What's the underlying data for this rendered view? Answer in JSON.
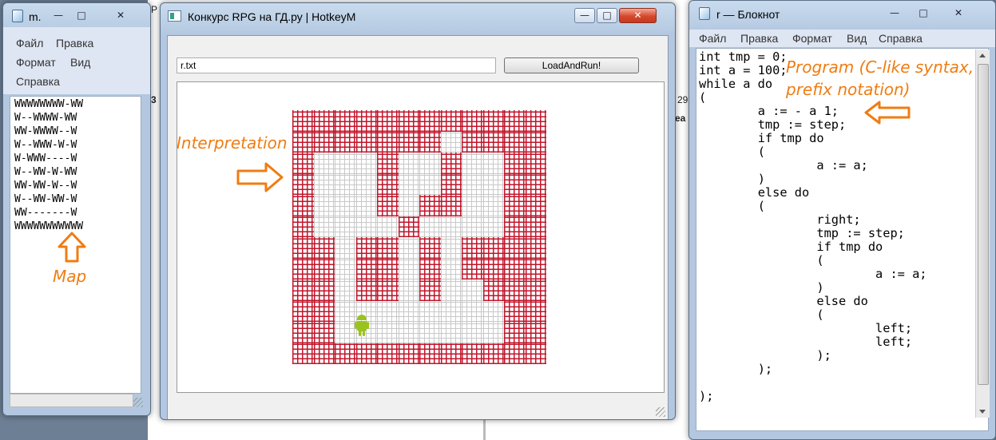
{
  "map_window": {
    "title": "m.",
    "controls": {
      "minimize": "—",
      "maximize": "□",
      "close": "✕"
    },
    "menu": [
      "Файл",
      "Правка",
      "Формат",
      "Вид",
      "Справка"
    ],
    "lines": [
      "WWWWWWWW-WW",
      "W--WWWW-WW",
      "WW-WWWW--W",
      "W--WWW-W-W",
      "W-WWW----W",
      "W--WW-W-WW",
      "WW-WW-W--W",
      "W--WW-WW-W",
      "WW-------W",
      "WWWWWWWWWWW"
    ]
  },
  "main_window": {
    "title": "Конкурс RPG на ГД.ру | HotkeyM",
    "controls": {
      "minimize": "—",
      "maximize": "□",
      "close": "✕"
    },
    "file_input_value": "r.txt",
    "run_button_label": "LoadAndRun!",
    "maze_rows": [
      "WWWWWWWWWWWW",
      "WWWWWWWFWWWW",
      "WFFFWFFWFFWW",
      "WFFFWFFWFFWW",
      "WFFFWFWWFFWW",
      "WFFFFWFFFFWW",
      "WWFWWFWFWWWW",
      "WWFWWFWFWWWW",
      "WWFWWFWFFWWW",
      "WWFFFFFFFFWW",
      "WWFFFFFFFFWW",
      "WWWWWWWWWWWW"
    ],
    "robot_icon": "android-robot-icon"
  },
  "notepad_window": {
    "title": "r — Блокнот",
    "controls": {
      "minimize": "—",
      "maximize": "□",
      "close": "✕"
    },
    "menu": [
      "Файл",
      "Правка",
      "Формат",
      "Вид",
      "Справка"
    ],
    "code": "int tmp = 0;\nint a = 100;\nwhile a do\n(\n\ta := - a 1;\n\ttmp := step;\n\tif tmp do\n\t(\n\t\ta := a;\n\t)\n\telse do\n\t(\n\t\tright;\n\t\ttmp := step;\n\t\tif tmp do\n\t\t(\n\t\t\ta := a;\n\t\t)\n\t\telse do\n\t\t(\n\t\t\tleft;\n\t\t\tleft;\n\t\t);\n\t);\n\n);"
  },
  "annotations": {
    "map": "Map",
    "interpretation": "Interpretation",
    "program_line1": "Program (C-like syntax,",
    "program_line2": "prefix notation)"
  },
  "background": {
    "text_1": "29",
    "text_2": "3",
    "text_3": "ea",
    "text_4": "JP"
  },
  "colors": {
    "wall": "#c0162b",
    "floor_grid": "#c8c8c8",
    "annotation": "#f07c12",
    "robot": "#9bc31f"
  }
}
